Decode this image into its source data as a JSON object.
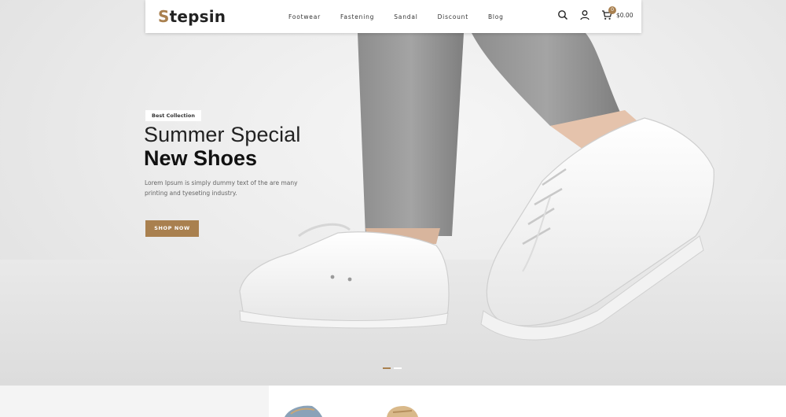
{
  "brand": {
    "logo_first": "S",
    "logo_rest": "tepsin",
    "accent": "#a9804f"
  },
  "nav": [
    {
      "label": "Footwear"
    },
    {
      "label": "Fastening"
    },
    {
      "label": "Sandal"
    },
    {
      "label": "Discount"
    },
    {
      "label": "Blog"
    }
  ],
  "header_icons": [
    "search-icon",
    "user-icon",
    "cart-icon"
  ],
  "cart": {
    "count": "0",
    "total": "$0.00"
  },
  "hero": {
    "badge": "Best Collection",
    "headline_line1": "Summer Special",
    "headline_line2": "New Shoes",
    "description": "Lorem Ipsum is simply dummy text of the are many printing and tyeseting industry.",
    "cta": "SHOP NOW",
    "slides": 2,
    "active_slide": 1
  }
}
